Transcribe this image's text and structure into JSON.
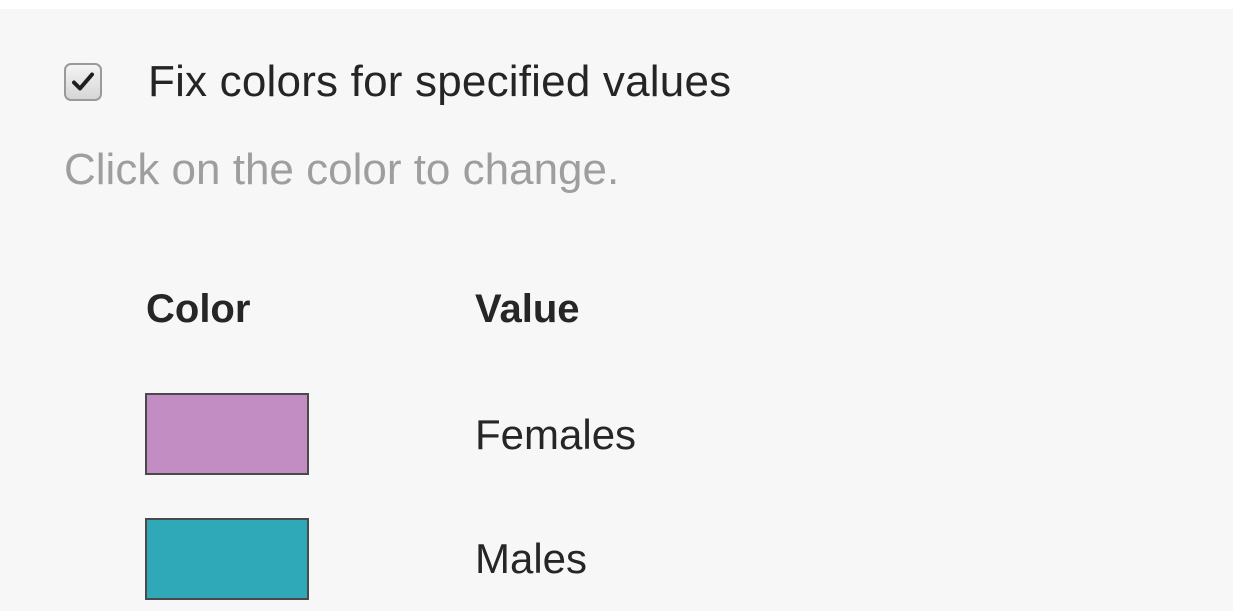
{
  "fix_colors": {
    "checked": true,
    "label": "Fix colors for specified values"
  },
  "hint": "Click on the color to change.",
  "table": {
    "headers": {
      "color": "Color",
      "value": "Value"
    },
    "rows": [
      {
        "value": "Females",
        "color": "#c28dc2"
      },
      {
        "value": "Males",
        "color": "#2fa8b8"
      }
    ]
  }
}
